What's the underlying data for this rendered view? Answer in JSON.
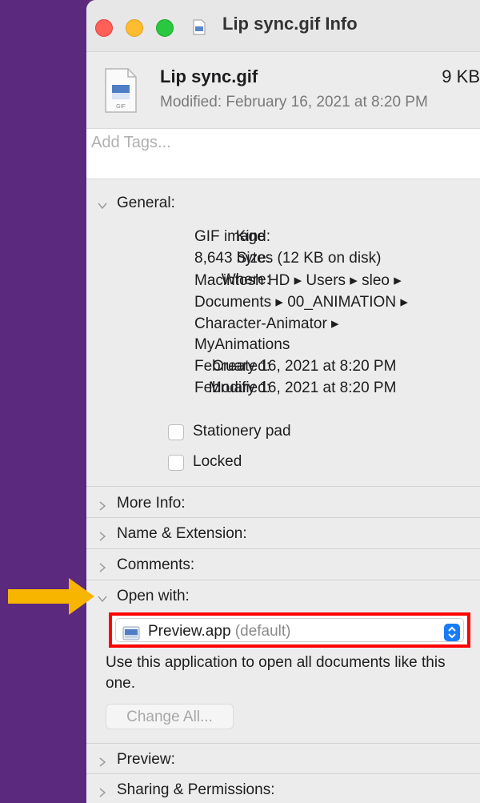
{
  "window": {
    "title": "Lip sync.gif Info"
  },
  "header": {
    "file_name": "Lip sync.gif",
    "file_size": "9 KB",
    "modified": "Modified: February 16, 2021 at 8:20 PM",
    "icon_label": "GIF"
  },
  "tags": {
    "placeholder": "Add Tags..."
  },
  "general": {
    "title": "General:",
    "kind_label": "Kind:",
    "kind": "GIF image",
    "size_label": "Size:",
    "size": "8,643 bytes (12 KB on disk)",
    "where_label": "Where:",
    "where_lines": [
      "Macintosh HD ▸ Users ▸ sleo ▸",
      "Documents ▸ 00_ANIMATION ▸",
      "Character-Animator ▸",
      "MyAnimations"
    ],
    "created_label": "Created:",
    "created": "February 16, 2021 at 8:20 PM",
    "modified_label": "Modified:",
    "modified": "February 16, 2021 at 8:20 PM",
    "stationery_label": "Stationery pad",
    "stationery_checked": false,
    "locked_label": "Locked",
    "locked_checked": false
  },
  "sections": {
    "more_info": "More Info:",
    "name_extension": "Name & Extension:",
    "comments": "Comments:",
    "open_with": "Open with:",
    "preview": "Preview:",
    "sharing": "Sharing & Permissions:"
  },
  "open_with": {
    "app_name": "Preview.app",
    "app_default": "(default)",
    "description": "Use this application to open all documents like this one.",
    "change_all": "Change All..."
  },
  "colors": {
    "background": "#5b2a7f",
    "highlight_box": "#ff0000",
    "arrow": "#f7b500",
    "accent": "#1a7cf5"
  }
}
